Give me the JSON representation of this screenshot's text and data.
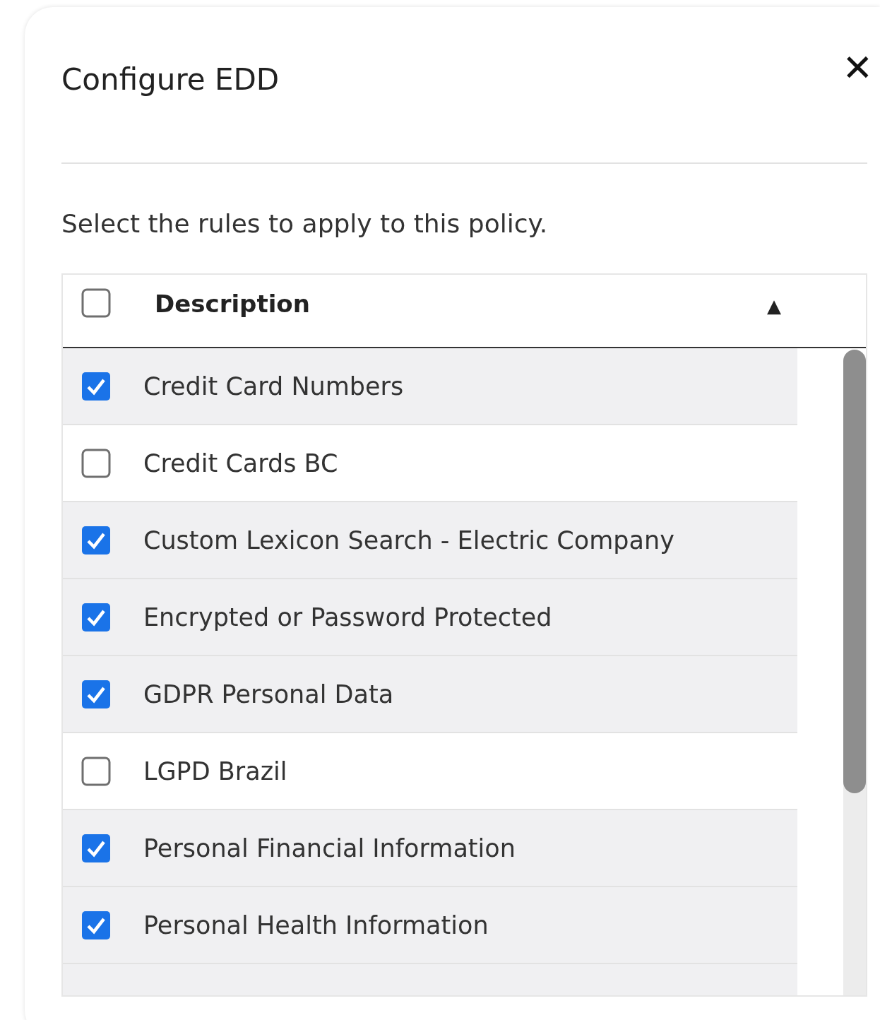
{
  "dialog": {
    "title": "Configure EDD",
    "close_label": "✕"
  },
  "instructions": "Select the rules to apply to this policy.",
  "table": {
    "header": {
      "checked": false,
      "label": "Description",
      "sort_icon": "▲"
    },
    "rows": [
      {
        "label": "Credit Card Numbers",
        "checked": true
      },
      {
        "label": "Credit Cards BC",
        "checked": false
      },
      {
        "label": "Custom Lexicon Search - Electric Company",
        "checked": true
      },
      {
        "label": "Encrypted or Password Protected",
        "checked": true
      },
      {
        "label": "GDPR Personal Data",
        "checked": true
      },
      {
        "label": "LGPD Brazil",
        "checked": false
      },
      {
        "label": "Personal Financial Information",
        "checked": true
      },
      {
        "label": "Personal Health Information",
        "checked": true
      }
    ]
  }
}
